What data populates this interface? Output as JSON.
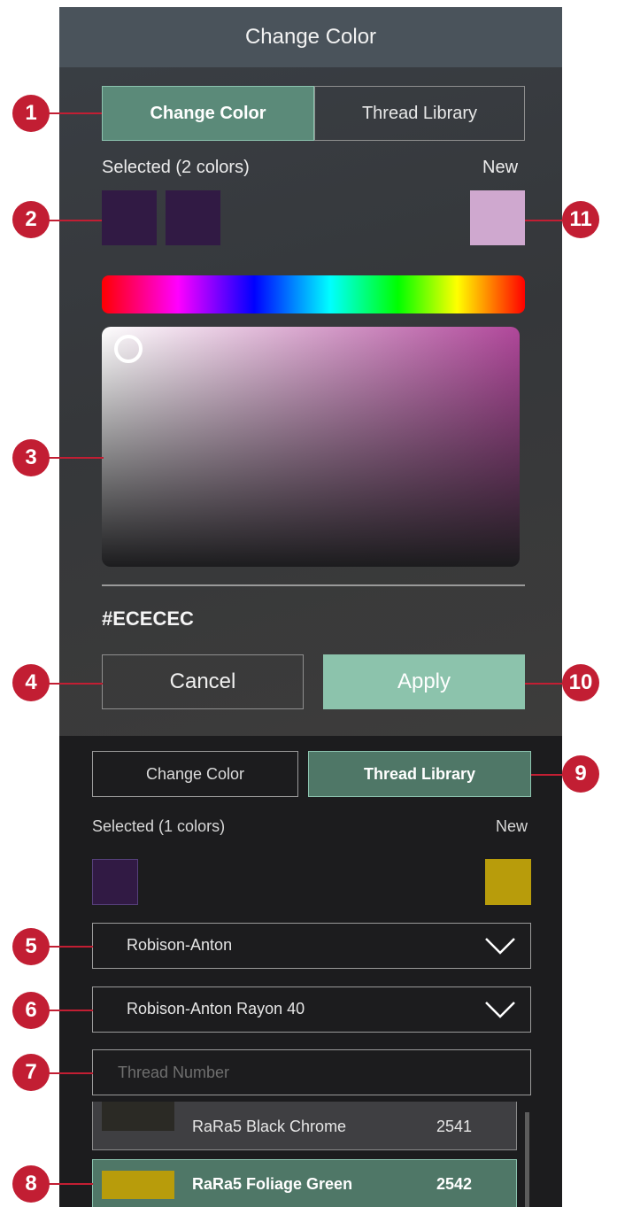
{
  "top_panel": {
    "title": "Change Color",
    "tabs": [
      {
        "label": "Change Color",
        "active": true
      },
      {
        "label": "Thread Library",
        "active": false
      }
    ],
    "selected_label": "Selected (2 colors)",
    "new_label": "New",
    "selected_swatches": [
      "#311a44",
      "#311a44"
    ],
    "new_swatch": "#cfa8cf",
    "picker_hue_color": "#b0479a",
    "hex_value": "#ECECEC",
    "cancel_label": "Cancel",
    "apply_label": "Apply"
  },
  "bottom_panel": {
    "tabs": [
      {
        "label": "Change Color",
        "active": false
      },
      {
        "label": "Thread Library",
        "active": true
      }
    ],
    "selected_label": "Selected (1 colors)",
    "new_label": "New",
    "selected_swatch": "#311a44",
    "new_swatch": "#b89c0b",
    "manufacturer_dropdown": "Robison-Anton",
    "thread_type_dropdown": "Robison-Anton Rayon 40",
    "thread_number_placeholder": "Thread Number",
    "thread_rows": [
      {
        "name": "RaRa5 Black Chrome",
        "number": "2541",
        "color": "#2b2a25",
        "selected": false
      },
      {
        "name": "RaRa5 Foliage Green",
        "number": "2542",
        "color": "#b89c0b",
        "selected": true
      }
    ]
  },
  "callouts": [
    "1",
    "2",
    "3",
    "4",
    "5",
    "6",
    "7",
    "8",
    "9",
    "10",
    "11"
  ],
  "accent_color": "#8cc3ac",
  "callout_color": "#c21e33"
}
